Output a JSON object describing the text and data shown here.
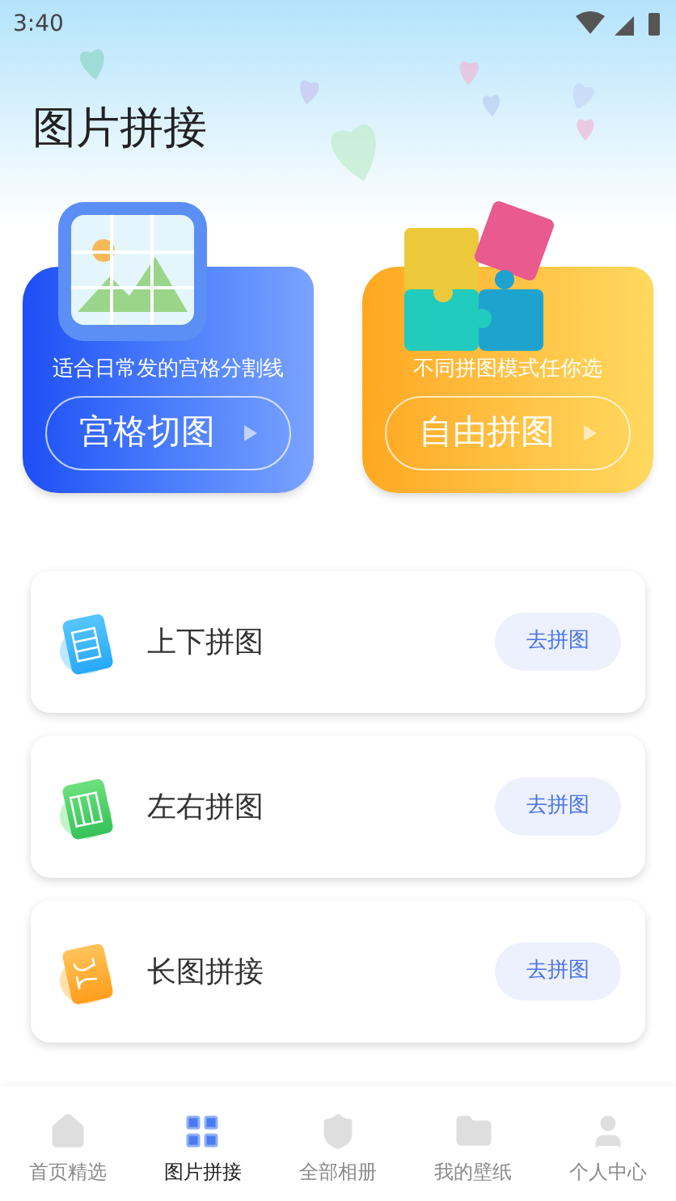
{
  "status_bar": {
    "time": "3:40"
  },
  "page_title": "图片拼接",
  "banners": [
    {
      "kind": "grid",
      "caption": "适合日常发的宫格分割线",
      "button": "宫格切图"
    },
    {
      "kind": "free",
      "caption": "不同拼图模式任你选",
      "button": "自由拼图"
    }
  ],
  "modes": [
    {
      "kind": "vertical",
      "label": "上下拼图",
      "button": "去拼图"
    },
    {
      "kind": "horizontal",
      "label": "左右拼图",
      "button": "去拼图"
    },
    {
      "kind": "long",
      "label": "长图拼接",
      "button": "去拼图"
    }
  ],
  "tab_bar": [
    {
      "kind": "home",
      "label": "首页精选",
      "selected": false
    },
    {
      "kind": "grid",
      "label": "图片拼接",
      "selected": true
    },
    {
      "kind": "shield",
      "label": "全部相册",
      "selected": false
    },
    {
      "kind": "folder",
      "label": "我的壁纸",
      "selected": false
    },
    {
      "kind": "user",
      "label": "个人中心",
      "selected": false
    }
  ]
}
